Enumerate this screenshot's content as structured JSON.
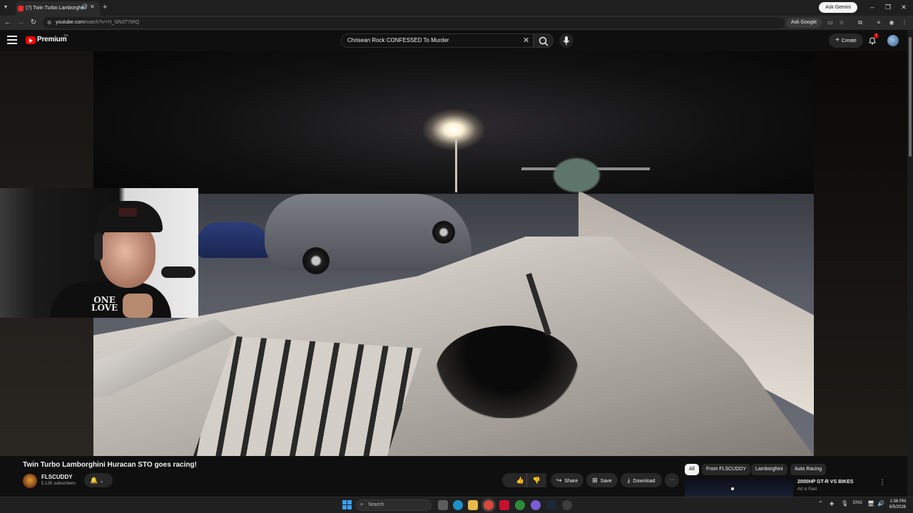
{
  "browser": {
    "tab_title": "(7) Twin Turbo Lamborghini",
    "new_tab_label": "+",
    "ask_gemini": "Ask Gemini",
    "url_host": "youtube.com",
    "url_path": "/watch?v=Yt_GN3T7tRQ",
    "ask_google": "Ask Google"
  },
  "header": {
    "brand": "Premium",
    "region": "TH",
    "search_value": "Chrisean Rock CONFESSED To Murder",
    "create_label": "Create",
    "notification_count": "7"
  },
  "webcam": {
    "shirt_text": "ONE\nLOVE"
  },
  "video": {
    "title": "Twin Turbo Lamborghini Huracan STO goes racing!",
    "channel_name": "FLSCUDDY",
    "subscribers": "5.12K subscribers",
    "like_count": "17",
    "share_label": "Share",
    "save_label": "Save",
    "download_label": "Download",
    "more_label": "···"
  },
  "related": {
    "chips": [
      "All",
      "From FLSCUDDY",
      "Lamborghini",
      "Auto Racing"
    ],
    "active_chip": "All",
    "first_video_title": "2000HP GT-R VS BIKES",
    "first_video_channel": "Art is Fast"
  },
  "taskbar": {
    "search_placeholder": "Search",
    "language": "ENG",
    "time": "1:06 PM",
    "date": "8/5/2026"
  },
  "colors": {
    "accent_red": "#ff0000",
    "background": "#0f0f0f",
    "surface": "#272727"
  }
}
